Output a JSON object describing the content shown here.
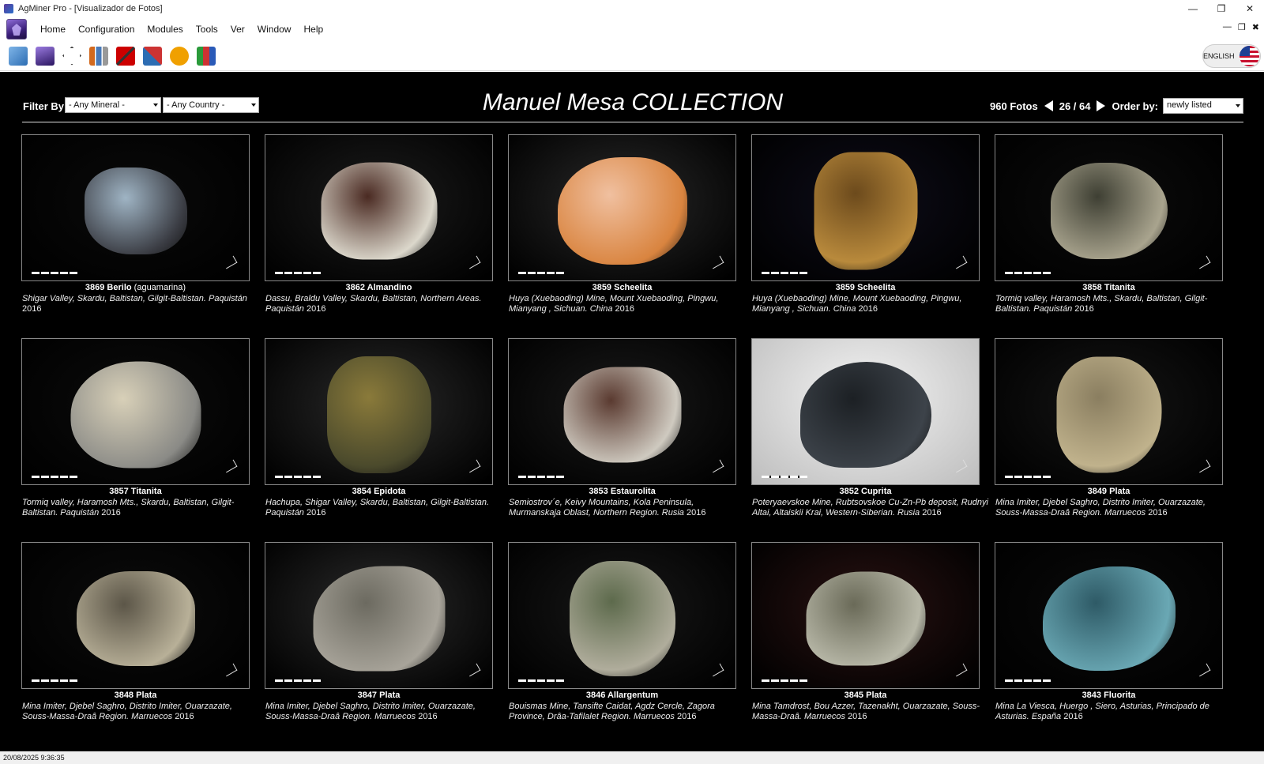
{
  "window": {
    "title": "AgMiner Pro - [Visualizador de Fotos]"
  },
  "menu": [
    "Home",
    "Configuration",
    "Modules",
    "Tools",
    "Ver",
    "Window",
    "Help"
  ],
  "toolbar": {
    "icons": [
      "minerals-map-icon",
      "crystal-app-icon",
      "diamond-outline-icon",
      "bar-chart-icon",
      "pick-hammer-icon",
      "miner-tools-icon",
      "hiker-icon",
      "books-icon"
    ],
    "language": "ENGLISH"
  },
  "header": {
    "filter_label": "Filter By:",
    "mineral_filter": "- Any Mineral -",
    "country_filter": "- Any Country -",
    "title": "Manuel Mesa COLLECTION",
    "photo_count": "960 Fotos",
    "page": "26 / 64",
    "order_label": "Order by:",
    "order_value": "newly listed"
  },
  "photos": [
    {
      "id": "3869",
      "mineral": "Berilo",
      "variety": "(aguamarina)",
      "location": "Shigar Valley, Skardu, Baltistan, Gilgit-Baltistan. Paquistán",
      "year": "2016",
      "bg": "#0a0a0a",
      "colors": [
        "#3b3d44",
        "#9fb4c4"
      ]
    },
    {
      "id": "3862",
      "mineral": "Almandino",
      "variety": "",
      "location": "Dassu, Braldu Valley, Skardu, Baltistan, Northern Areas. Paquistán",
      "year": "2016",
      "bg": "#1c1c1c",
      "colors": [
        "#dcd8cc",
        "#4a2a22"
      ]
    },
    {
      "id": "3859",
      "mineral": "Scheelita",
      "variety": "",
      "location": "Huya (Xuebaoding) Mine, Mount Xuebaoding, Pingwu, Mianyang , Sichuan. China",
      "year": "2016",
      "bg": "#2a2a2a",
      "colors": [
        "#d9843f",
        "#f0c0a0"
      ]
    },
    {
      "id": "3859",
      "mineral": "Scheelita",
      "variety": "",
      "location": "Huya (Xuebaoding) Mine, Mount Xuebaoding, Pingwu, Mianyang , Sichuan. China",
      "year": "2016",
      "bg": "#0e0d1a",
      "colors": [
        "#b98a3c",
        "#6c4a1c"
      ]
    },
    {
      "id": "3858",
      "mineral": "Titanita",
      "variety": "",
      "location": "Tormiq valley, Haramosh Mts., Skardu, Baltistan, Gilgit-Baltistan. Paquistán",
      "year": "2016",
      "bg": "#0c0c0c",
      "colors": [
        "#a9a48e",
        "#3e3f33"
      ]
    },
    {
      "id": "3857",
      "mineral": "Titanita",
      "variety": "",
      "location": "Tormiq valley, Haramosh Mts., Skardu, Baltistan, Gilgit-Baltistan. Paquistán",
      "year": "2016",
      "bg": "#0c0c0c",
      "colors": [
        "#8a8a86",
        "#d8d0b8"
      ]
    },
    {
      "id": "3854",
      "mineral": "Epidota",
      "variety": "",
      "location": "Hachupa, Shigar Valley, Skardu, Baltistan, Gilgit-Baltistan. Paquistán",
      "year": "2016",
      "bg": "#2a2a2a",
      "colors": [
        "#4b4a2c",
        "#8a7a3a"
      ]
    },
    {
      "id": "3853",
      "mineral": "Estaurolita",
      "variety": "",
      "location": "Semiostrov´e, Keivy Mountains, Kola Peninsula, Murmanskaja Oblast, Northern Region. Rusia",
      "year": "2016",
      "bg": "#1a1a1a",
      "colors": [
        "#cfcac0",
        "#5a3a30"
      ]
    },
    {
      "id": "3852",
      "mineral": "Cuprita",
      "variety": "",
      "location": "Poteryaevskoe Mine, Rubtsovskoe Cu-Zn-Pb deposit, Rudnyi Altai, Altaiskii Krai, Western-Siberian. Rusia",
      "year": "2016",
      "bg": "#e4e4e4",
      "colors": [
        "#3d434a",
        "#1c2024"
      ]
    },
    {
      "id": "3849",
      "mineral": "Plata",
      "variety": "",
      "location": "Mina Imiter, Djebel Saghro, Distrito Imiter, Ouarzazate, Souss-Massa-Draâ Region. Marruecos",
      "year": "2016",
      "bg": "#151515",
      "colors": [
        "#c0b28c",
        "#8a7e60"
      ]
    },
    {
      "id": "3848",
      "mineral": "Plata",
      "variety": "",
      "location": "Mina Imiter, Djebel Saghro, Distrito Imiter, Ouarzazate, Souss-Massa-Draâ Region. Marruecos",
      "year": "2016",
      "bg": "#0c0c0c",
      "colors": [
        "#b8b098",
        "#5c5648"
      ]
    },
    {
      "id": "3847",
      "mineral": "Plata",
      "variety": "",
      "location": "Mina Imiter, Djebel Saghro, Distrito Imiter, Ouarzazate, Souss-Massa-Draâ Region. Marruecos",
      "year": "2016",
      "bg": "#2c2c2c",
      "colors": [
        "#a8a49a",
        "#6c6a60"
      ]
    },
    {
      "id": "3846",
      "mineral": "Allargentum",
      "variety": "",
      "location": "Bouismas Mine, Tansifte Caidat, Agdz Cercle, Zagora Province, Drâa-Tafilalet Region. Marruecos",
      "year": "2016",
      "bg": "#181818",
      "colors": [
        "#b0ad9c",
        "#5d6a4c"
      ]
    },
    {
      "id": "3845",
      "mineral": "Plata",
      "variety": "",
      "location": "Mina Tamdrost, Bou Azzer, Tazenakht, Ouarzazate, Souss-Massa-Draâ. Marruecos",
      "year": "2016",
      "bg": "#2a1212",
      "colors": [
        "#b8b8a8",
        "#6a6a58"
      ]
    },
    {
      "id": "3843",
      "mineral": "Fluorita",
      "variety": "",
      "location": "Mina La Viesca, Huergo , Siero, Asturias, Principado de Asturias. España",
      "year": "2016",
      "bg": "#0a0a0a",
      "colors": [
        "#6aa8b4",
        "#2e5a66"
      ]
    }
  ],
  "status": {
    "datetime": "20/08/2025 9:36:35"
  }
}
